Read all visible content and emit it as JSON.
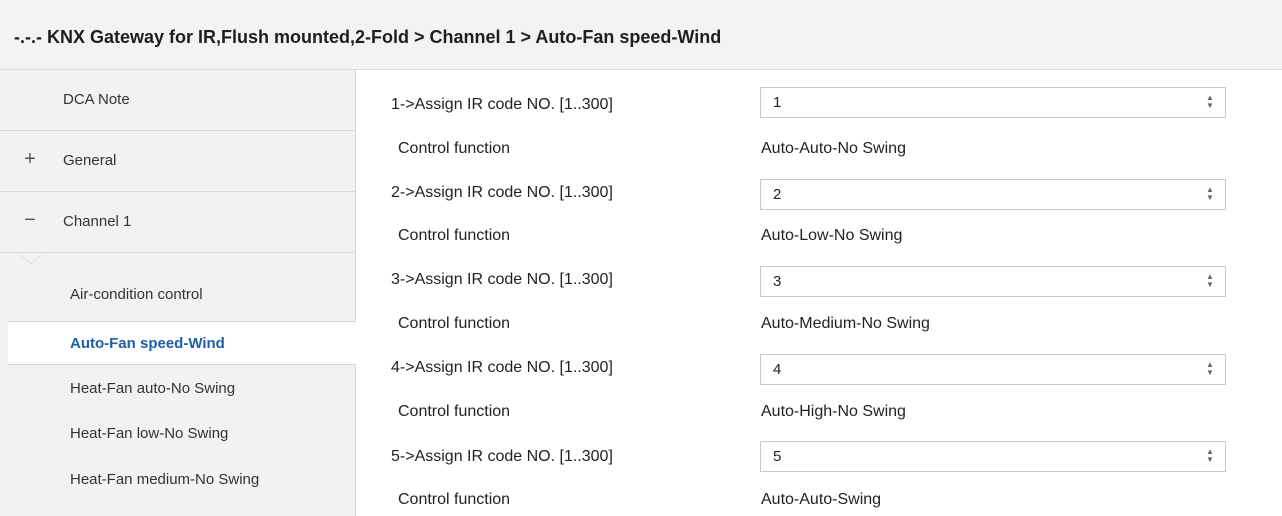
{
  "header": {
    "title": "-.-.- KNX Gateway for IR,Flush mounted,2-Fold > Channel 1 > Auto-Fan speed-Wind"
  },
  "sidebar": {
    "items": [
      {
        "label": "DCA Note",
        "sign": ""
      },
      {
        "label": "General",
        "sign": "+"
      },
      {
        "label": "Channel 1",
        "sign": "−"
      }
    ],
    "sub_items": [
      {
        "label": "Air-condition control"
      },
      {
        "label": "Auto-Fan speed-Wind"
      },
      {
        "label": "Heat-Fan auto-No Swing"
      },
      {
        "label": "Heat-Fan low-No Swing"
      },
      {
        "label": "Heat-Fan medium-No Swing"
      }
    ]
  },
  "main": {
    "rows": [
      {
        "assign_label": "1->Assign IR code NO. [1..300]",
        "value": "1",
        "cf_label": "Control function",
        "cf_value": "Auto-Auto-No Swing"
      },
      {
        "assign_label": "2->Assign IR code NO. [1..300]",
        "value": "2",
        "cf_label": "Control function",
        "cf_value": "Auto-Low-No Swing"
      },
      {
        "assign_label": "3->Assign IR code NO. [1..300]",
        "value": "3",
        "cf_label": "Control function",
        "cf_value": "Auto-Medium-No Swing"
      },
      {
        "assign_label": "4->Assign IR code NO. [1..300]",
        "value": "4",
        "cf_label": "Control function",
        "cf_value": "Auto-High-No Swing"
      },
      {
        "assign_label": "5->Assign IR code NO. [1..300]",
        "value": "5",
        "cf_label": "Control function",
        "cf_value": "Auto-Auto-Swing"
      }
    ]
  },
  "icons": {
    "spin_up": "spin-up-icon",
    "spin_down": "spin-down-icon"
  },
  "colors": {
    "selected_text": "#1f5fa8"
  }
}
